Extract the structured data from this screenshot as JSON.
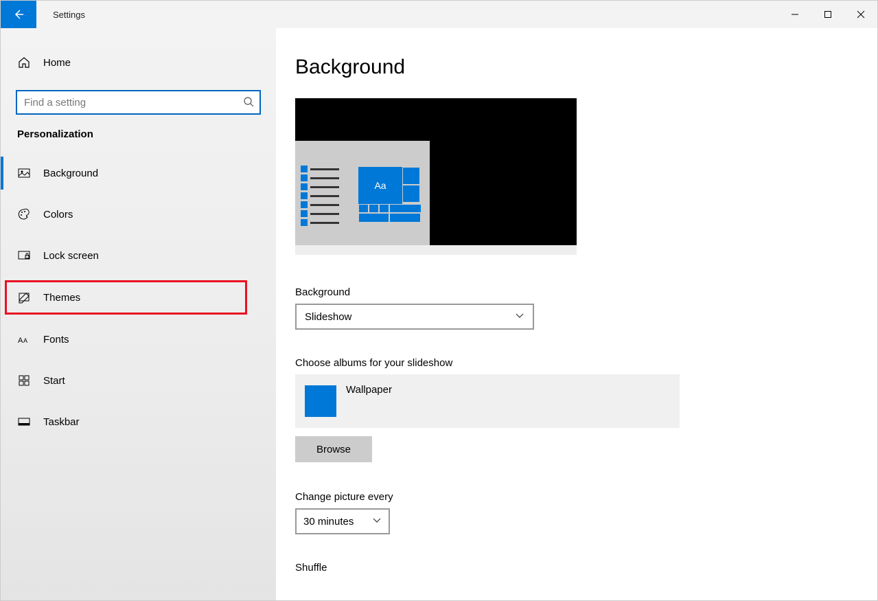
{
  "window": {
    "title": "Settings"
  },
  "sidebar": {
    "home_label": "Home",
    "search_placeholder": "Find a setting",
    "section": "Personalization",
    "items": [
      {
        "label": "Background"
      },
      {
        "label": "Colors"
      },
      {
        "label": "Lock screen"
      },
      {
        "label": "Themes"
      },
      {
        "label": "Fonts"
      },
      {
        "label": "Start"
      },
      {
        "label": "Taskbar"
      }
    ]
  },
  "main": {
    "title": "Background",
    "preview_text": "Aa",
    "background_label": "Background",
    "background_value": "Slideshow",
    "albums_label": "Choose albums for your slideshow",
    "album_name": "Wallpaper",
    "browse_label": "Browse",
    "change_label": "Change picture every",
    "change_value": "30 minutes",
    "shuffle_label": "Shuffle"
  }
}
